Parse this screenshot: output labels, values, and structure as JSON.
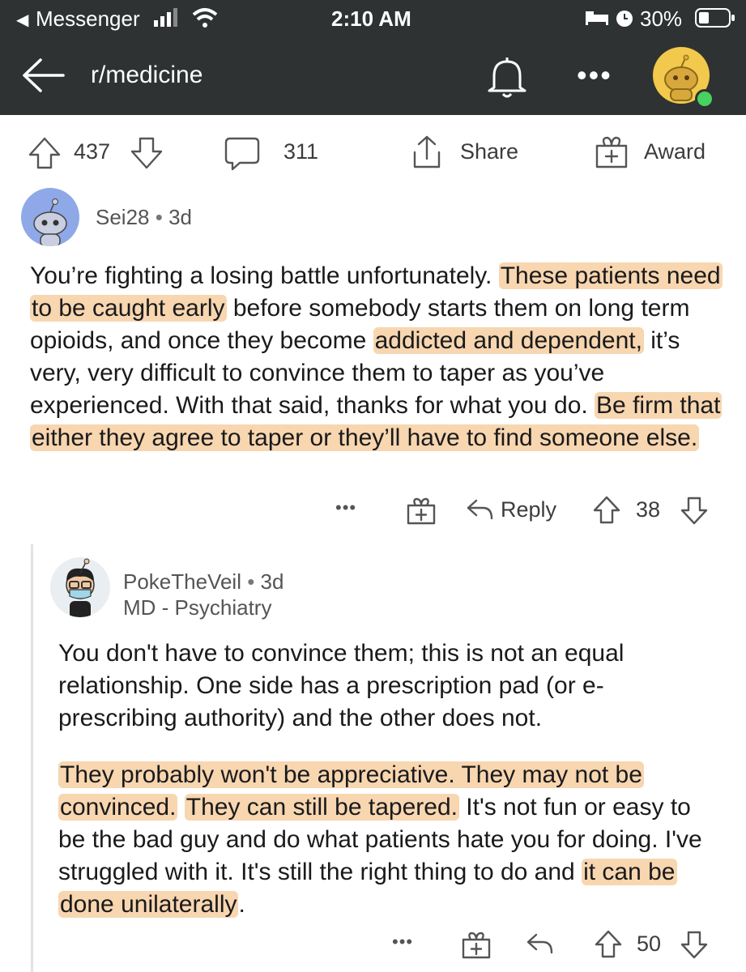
{
  "status_bar": {
    "back_app": "Messenger",
    "time": "2:10 AM",
    "battery": "30%"
  },
  "nav": {
    "subreddit": "r/medicine"
  },
  "post_actions": {
    "upvotes": "437",
    "comments": "311",
    "share_label": "Share",
    "award_label": "Award"
  },
  "comment1": {
    "author": "Sei28",
    "age": "3d",
    "body_segments": [
      {
        "text": "You’re fighting a losing battle unfortunately. ",
        "hl": false
      },
      {
        "text": "These patients need to be caught early",
        "hl": true
      },
      {
        "text": " before somebody starts them on long term opioids, and once they become ",
        "hl": false
      },
      {
        "text": "addicted and dependent,",
        "hl": true
      },
      {
        "text": " it’s very, very difficult to convince them to taper as you’ve experienced. With that said, thanks for what you do. ",
        "hl": false
      },
      {
        "text": "Be firm that either they agree to taper or they’ll have to find someone else.",
        "hl": true
      }
    ],
    "reply_label": "Reply",
    "score": "38"
  },
  "comment2": {
    "author": "PokeTheVeil",
    "age": "3d",
    "flair": "MD - Psychiatry",
    "para1": "You don't have to convince them; this is not an equal relationship. One side has a prescription pad (or e-prescribing authority) and the other does not.",
    "para2_segments": [
      {
        "text": "They probably won't be appreciative. They may not be convinced.",
        "hl": true
      },
      {
        "text": " ",
        "hl": false
      },
      {
        "text": "They can still be tapered.",
        "hl": true
      },
      {
        "text": " It's not fun or easy to be the bad guy and do what patients hate you for doing.  I've struggled with it. It's still the right thing to do and ",
        "hl": false
      },
      {
        "text": "it can be done unilaterally",
        "hl": true
      },
      {
        "text": ".",
        "hl": false
      }
    ],
    "score": "50"
  }
}
